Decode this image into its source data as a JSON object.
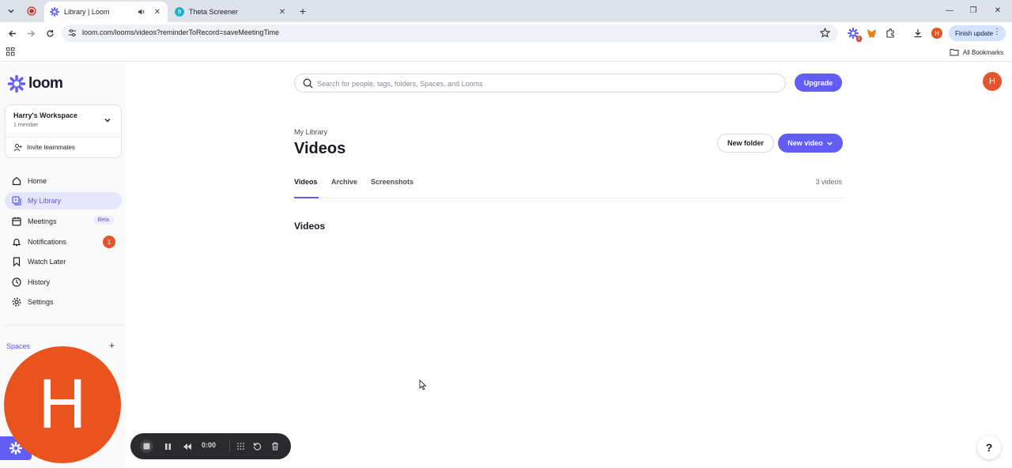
{
  "browser": {
    "tabs": [
      {
        "title": "Library | Loom",
        "active": true,
        "favicon": "loom-icon",
        "audio": true
      },
      {
        "title": "Theta Screener",
        "active": false,
        "favicon": "theta-icon"
      }
    ],
    "url": "loom.com/looms/videos?reminderToRecord=saveMeetingTime",
    "finish_update_label": "Finish update",
    "profile_initial": "H",
    "extension_badge": "1",
    "all_bookmarks_label": "All Bookmarks"
  },
  "sidebar": {
    "brand": "loom",
    "workspace": {
      "name": "Harry's Workspace",
      "members": "1 member",
      "invite_label": "Invite teammates"
    },
    "items": [
      {
        "label": "Home",
        "icon": "home-icon"
      },
      {
        "label": "My Library",
        "icon": "library-icon",
        "active": true
      },
      {
        "label": "Meetings",
        "icon": "calendar-icon",
        "badge": "Beta"
      },
      {
        "label": "Notifications",
        "icon": "bell-icon",
        "count": "1"
      },
      {
        "label": "Watch Later",
        "icon": "bookmark-icon"
      },
      {
        "label": "History",
        "icon": "clock-icon"
      },
      {
        "label": "Settings",
        "icon": "gear-icon"
      }
    ],
    "spaces_label": "Spaces"
  },
  "header": {
    "search_placeholder": "Search for people, tags, folders, Spaces, and Looms",
    "upgrade_label": "Upgrade",
    "user_initial": "H"
  },
  "library": {
    "breadcrumb": "My Library",
    "title": "Videos",
    "new_folder_label": "New folder",
    "new_video_label": "New video",
    "tabs": [
      "Videos",
      "Archive",
      "Screenshots"
    ],
    "video_count": "3 videos",
    "section_heading": "Videos"
  },
  "recorder": {
    "avatar_initial": "H",
    "time": "0:00"
  },
  "help_label": "?",
  "colors": {
    "accent": "#625df5",
    "avatar": "#ea531e",
    "badge": "#e5552c"
  }
}
